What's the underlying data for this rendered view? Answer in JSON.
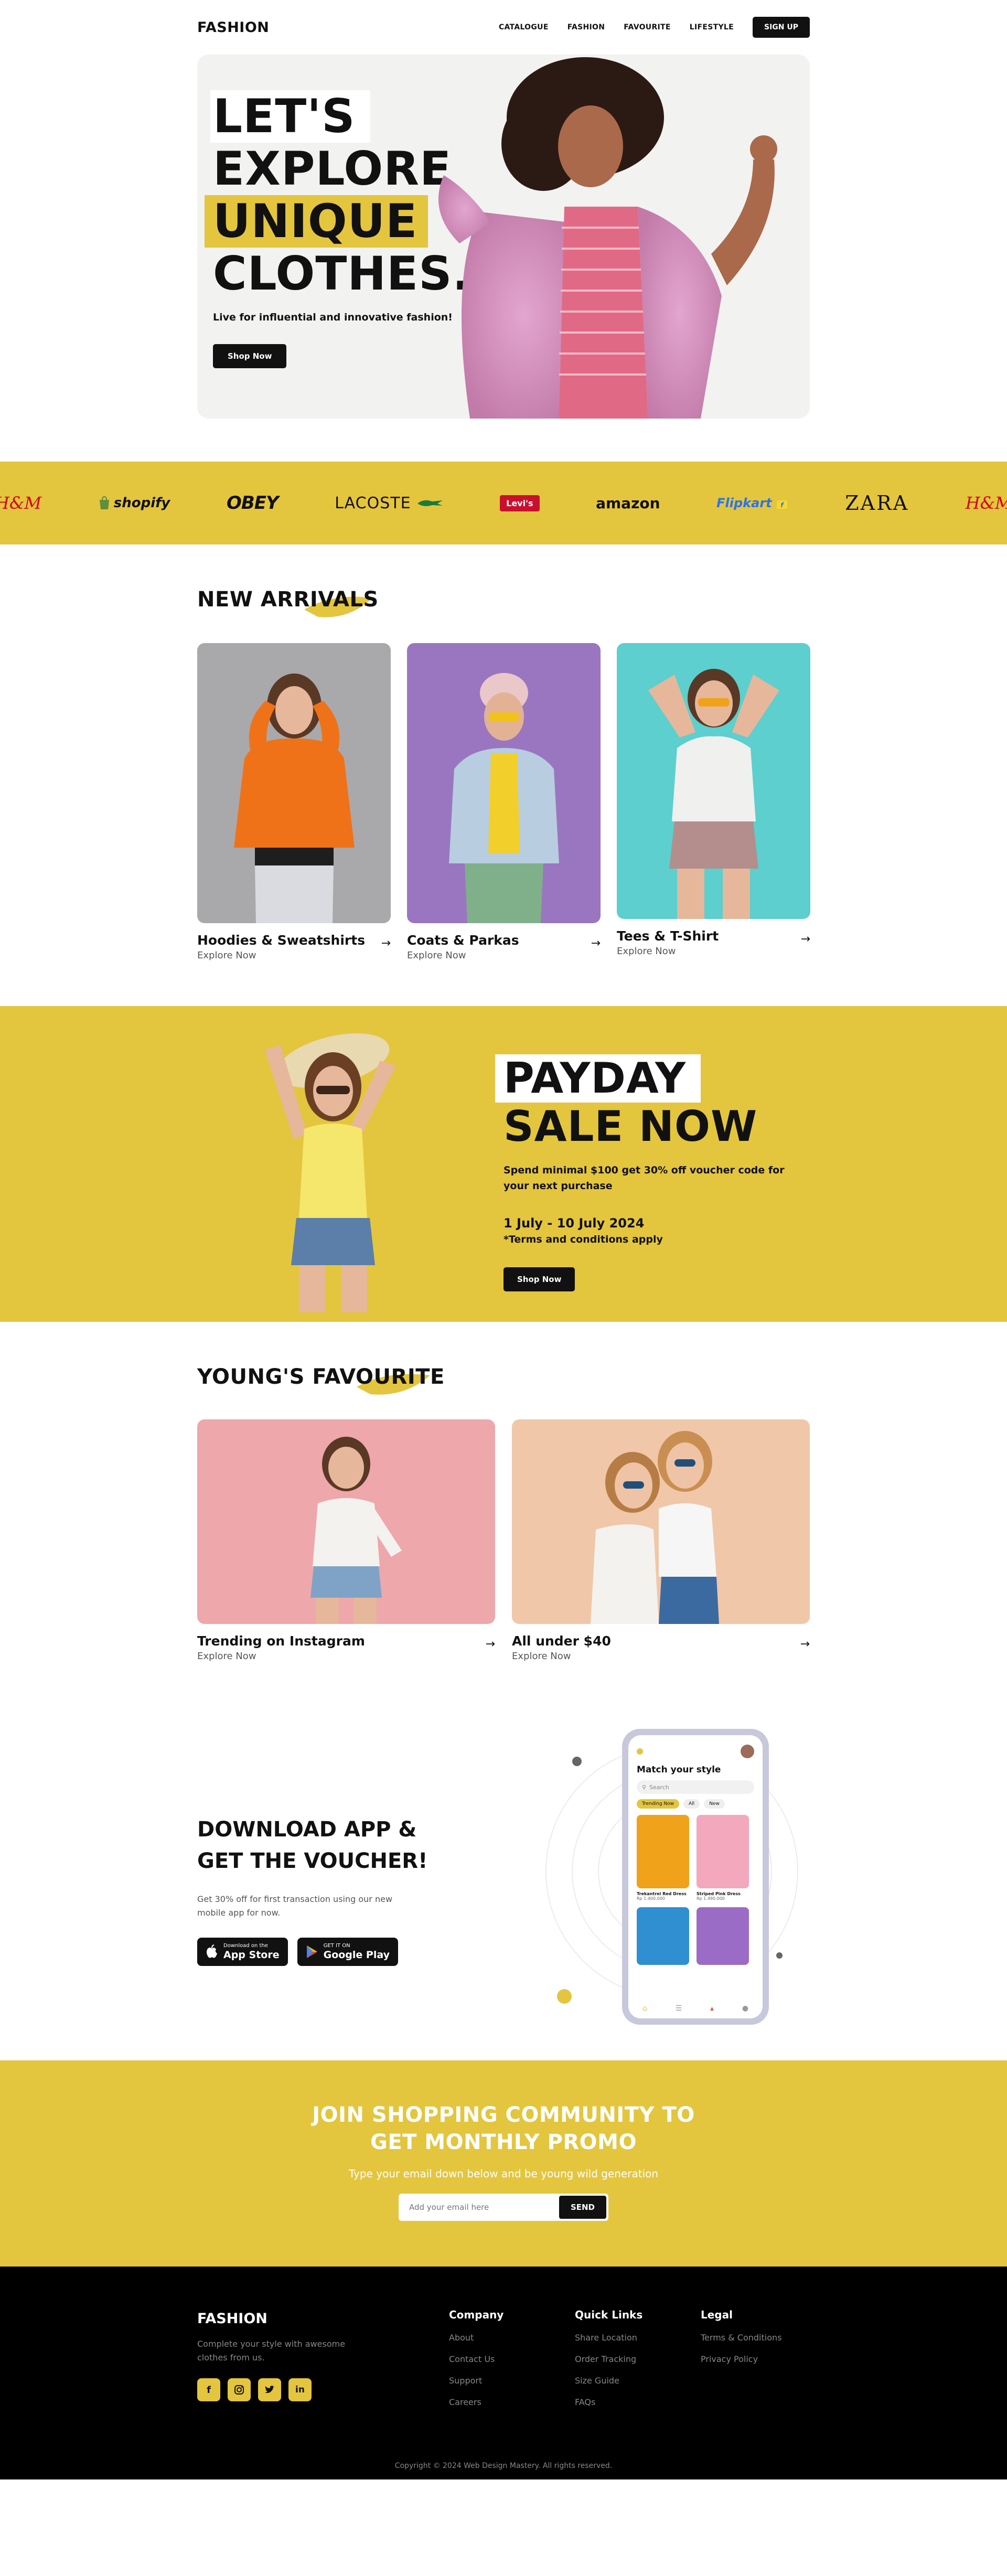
{
  "nav": {
    "logo": "FASHION",
    "links": [
      "CATALOGUE",
      "FASHION",
      "FAVOURITE",
      "LIFESTYLE"
    ],
    "signup": "SIGN UP"
  },
  "hero": {
    "lines": [
      "LET'S",
      "EXPLORE",
      "UNIQUE",
      "CLOTHES."
    ],
    "tagline": "Live for influential and innovative fashion!",
    "button": "Shop Now"
  },
  "brands": [
    "H&M",
    "shopify",
    "OBEY",
    "LACOSTE",
    "Levi's",
    "amazon",
    "Flipkart",
    "ZARA",
    "H&M"
  ],
  "new_arrivals": {
    "title": "NEW ARRIVALS",
    "items": [
      {
        "name": "Hoodies & Sweatshirts",
        "sub": "Explore Now"
      },
      {
        "name": "Coats & Parkas",
        "sub": "Explore Now"
      },
      {
        "name": "Tees & T-Shirt",
        "sub": "Explore Now"
      }
    ]
  },
  "payday": {
    "line1": "PAYDAY",
    "line2": "SALE NOW",
    "desc": "Spend minimal $100 get 30% off voucher code for your next purchase",
    "date": "1 July - 10 July 2024",
    "terms": "*Terms and conditions apply",
    "button": "Shop Now"
  },
  "youngs": {
    "title": "YOUNG'S FAVOURITE",
    "items": [
      {
        "name": "Trending on Instagram",
        "sub": "Explore Now"
      },
      {
        "name": "All under $40",
        "sub": "Explore Now"
      }
    ]
  },
  "app": {
    "title_line1": "DOWNLOAD APP &",
    "title_line2": "GET THE VOUCHER!",
    "desc": "Get 30% off for first transaction using our new mobile app for now.",
    "appstore_small": "Download on the",
    "appstore_big": "App Store",
    "googleplay_small": "GET IT ON",
    "googleplay_big": "Google Play",
    "phone": {
      "title": "Match your style",
      "search": "Search",
      "chips": [
        "Trending Now",
        "All",
        "New"
      ],
      "products": [
        {
          "name": "Trekantrei Red Dress",
          "price": "Rp 1.400.000"
        },
        {
          "name": "Striped Pink Dress",
          "price": "Rp 1.490.000"
        }
      ]
    }
  },
  "join": {
    "title_line1": "JOIN SHOPPING COMMUNITY TO",
    "title_line2": "GET MONTHLY PROMO",
    "sub": "Type your email down below and be young wild generation",
    "placeholder": "Add your email here",
    "button": "SEND"
  },
  "footer": {
    "logo": "FASHION",
    "desc": "Complete your style with awesome clothes from us.",
    "socials": [
      "f",
      "ig",
      "tw",
      "in"
    ],
    "columns": [
      {
        "title": "Company",
        "items": [
          "About",
          "Contact Us",
          "Support",
          "Careers"
        ]
      },
      {
        "title": "Quick Links",
        "items": [
          "Share Location",
          "Order Tracking",
          "Size Guide",
          "FAQs"
        ]
      },
      {
        "title": "Legal",
        "items": [
          "Terms & Conditions",
          "Privacy Policy"
        ]
      }
    ],
    "copyright": "Copyright © 2024 Web Design Mastery. All rights reserved."
  },
  "colors": {
    "accent": "#e4c53e",
    "dark": "#111111"
  }
}
